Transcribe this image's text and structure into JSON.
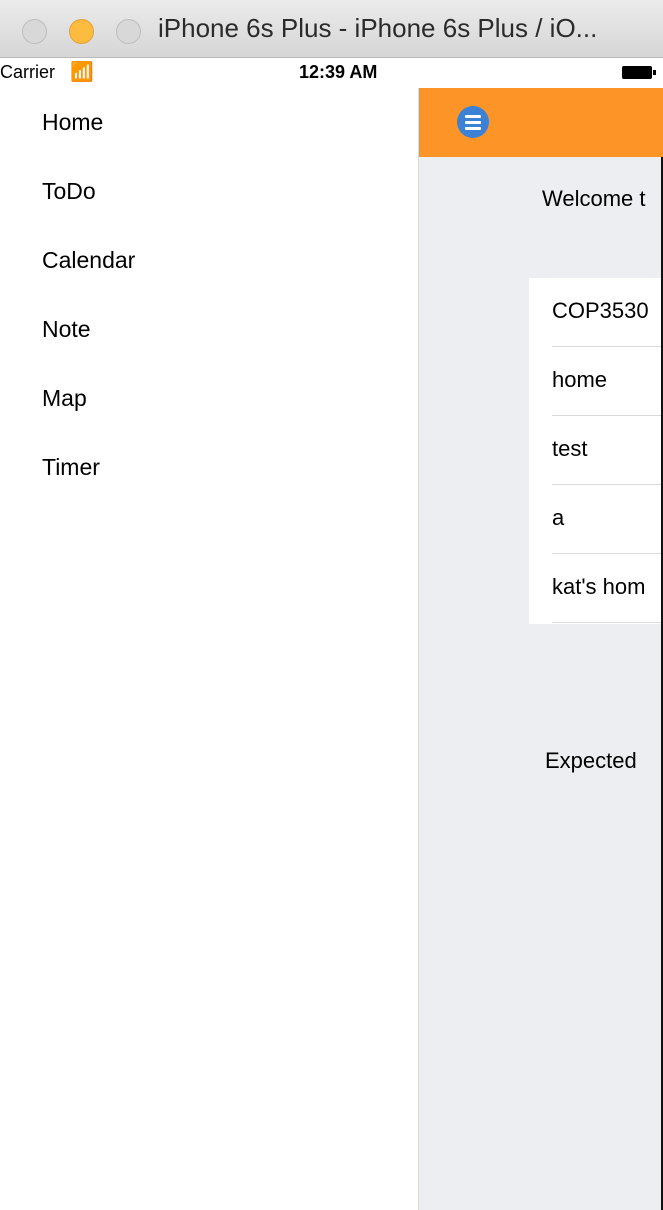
{
  "window": {
    "title": "iPhone 6s Plus - iPhone 6s Plus / iO..."
  },
  "status_bar": {
    "carrier": "Carrier",
    "wifi_icon": "wifi-icon",
    "time": "12:39 AM",
    "battery_icon": "battery-icon"
  },
  "side_menu": {
    "items": [
      {
        "label": "Home"
      },
      {
        "label": "ToDo"
      },
      {
        "label": "Calendar"
      },
      {
        "label": "Note"
      },
      {
        "label": "Map"
      },
      {
        "label": "Timer"
      }
    ]
  },
  "main": {
    "navbar_color": "#fd9428",
    "menu_button_icon": "hamburger-menu-icon",
    "welcome_text": "Welcome t",
    "list": [
      {
        "label": "COP3530"
      },
      {
        "label": "home"
      },
      {
        "label": "test"
      },
      {
        "label": "a"
      },
      {
        "label": "kat's hom"
      }
    ],
    "expected_text": "Expected"
  }
}
